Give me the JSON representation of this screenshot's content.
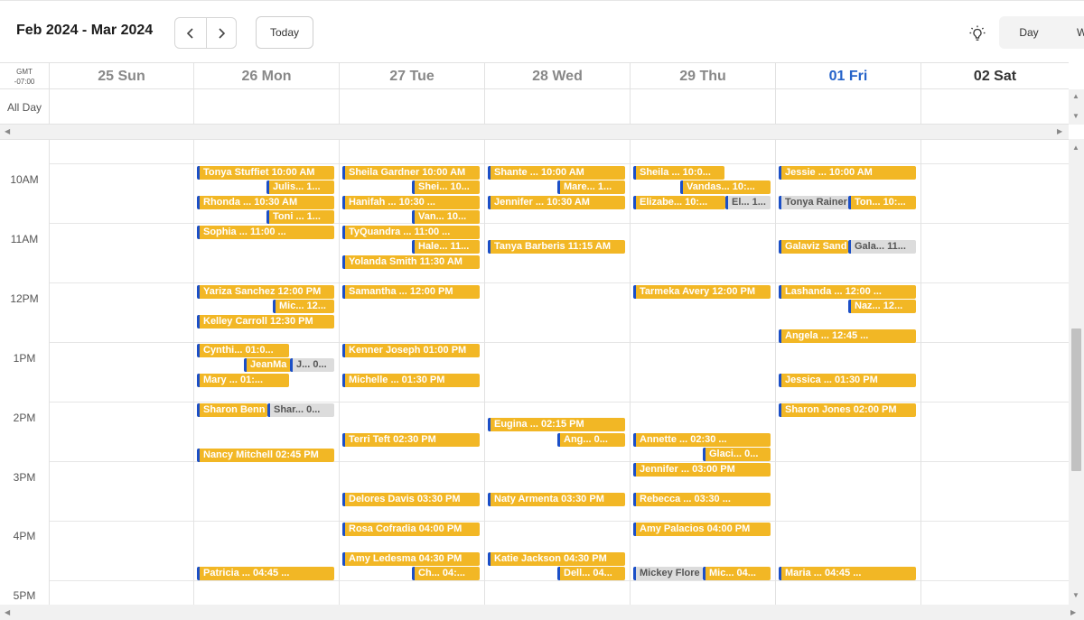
{
  "toolbar": {
    "range_title": "Feb 2024 - Mar 2024",
    "prev_icon": "chevron-left-icon",
    "next_icon": "chevron-right-icon",
    "today_label": "Today",
    "theme_icon": "lightbulb-icon",
    "view_day": "Day",
    "view_week": "W"
  },
  "header": {
    "gmt_line1": "GMT",
    "gmt_line2": "-07:00",
    "days": [
      "25 Sun",
      "26 Mon",
      "27 Tue",
      "28 Wed",
      "29 Thu",
      "01 Fri",
      "02 Sat"
    ]
  },
  "allday_label": "All Day",
  "time_labels": [
    "10AM",
    "11AM",
    "12PM",
    "1PM",
    "2PM",
    "3PM",
    "4PM",
    "5PM"
  ],
  "colors": {
    "event_fill": "#f2b725",
    "event_accent": "#1b4fc7",
    "event_alt_fill": "#dcdcdc",
    "today_text": "#2563c9"
  },
  "events": [
    {
      "day": 1,
      "text": "Tonya Stuffiet 10:00 AM",
      "style": "gold"
    },
    {
      "day": 1,
      "text": "Julis... 1...",
      "style": "gold"
    },
    {
      "day": 1,
      "text": "Rhonda ...     10:30 AM",
      "style": "gold"
    },
    {
      "day": 1,
      "text": "Toni ... 1...",
      "style": "gold"
    },
    {
      "day": 1,
      "text": "Sophia ...       11:00 ...",
      "style": "gold"
    },
    {
      "day": 1,
      "text": "Yariza Sanchez 12:00 PM",
      "style": "gold"
    },
    {
      "day": 1,
      "text": "Mic... 12...",
      "style": "gold"
    },
    {
      "day": 1,
      "text": "Kelley Carroll 12:30 PM",
      "style": "gold"
    },
    {
      "day": 1,
      "text": "Cynthi... 01:0...",
      "style": "gold"
    },
    {
      "day": 1,
      "text": "JeanMa",
      "style": "gold"
    },
    {
      "day": 1,
      "text": "J... 0...",
      "style": "gray"
    },
    {
      "day": 1,
      "text": "Mary ... 01:...",
      "style": "gold"
    },
    {
      "day": 1,
      "text": "Sharon Benn",
      "style": "gold"
    },
    {
      "day": 1,
      "text": "Shar... 0...",
      "style": "gray"
    },
    {
      "day": 1,
      "text": "Nancy Mitchell 02:45 PM",
      "style": "gold"
    },
    {
      "day": 1,
      "text": "Patricia ...      04:45 ...",
      "style": "gold"
    },
    {
      "day": 2,
      "text": "Sheila Gardner 10:00 AM",
      "style": "gold"
    },
    {
      "day": 2,
      "text": "Shei... 10...",
      "style": "gold"
    },
    {
      "day": 2,
      "text": "Hanifah ...      10:30 ...",
      "style": "gold"
    },
    {
      "day": 2,
      "text": "Van... 10...",
      "style": "gold"
    },
    {
      "day": 2,
      "text": "TyQuandra ...  11:00 ...",
      "style": "gold"
    },
    {
      "day": 2,
      "text": "Hale... 11...",
      "style": "gold"
    },
    {
      "day": 2,
      "text": "Yolanda Smith 11:30 AM",
      "style": "gold"
    },
    {
      "day": 2,
      "text": "Samantha ...      12:00 PM",
      "style": "gold"
    },
    {
      "day": 2,
      "text": "Kenner Joseph 01:00 PM",
      "style": "gold"
    },
    {
      "day": 2,
      "text": "Michelle ...       01:30 PM",
      "style": "gold"
    },
    {
      "day": 2,
      "text": "Terri Teft 02:30 PM",
      "style": "gold"
    },
    {
      "day": 2,
      "text": "Delores Davis 03:30 PM",
      "style": "gold"
    },
    {
      "day": 2,
      "text": "Rosa Cofradia 04:00 PM",
      "style": "gold"
    },
    {
      "day": 2,
      "text": "Amy Ledesma 04:30 PM",
      "style": "gold"
    },
    {
      "day": 2,
      "text": "Ch... 04:...",
      "style": "gold"
    },
    {
      "day": 3,
      "text": "Shante ...       10:00 AM",
      "style": "gold"
    },
    {
      "day": 3,
      "text": "Mare... 1...",
      "style": "gold"
    },
    {
      "day": 3,
      "text": "Jennifer ...      10:30 AM",
      "style": "gold"
    },
    {
      "day": 3,
      "text": "Tanya Barberis 11:15 AM",
      "style": "gold"
    },
    {
      "day": 3,
      "text": "Eugina ...        02:15 PM",
      "style": "gold"
    },
    {
      "day": 3,
      "text": "Ang... 0...",
      "style": "gold"
    },
    {
      "day": 3,
      "text": "Naty Armenta 03:30 PM",
      "style": "gold"
    },
    {
      "day": 3,
      "text": "Katie Jackson 04:30 PM",
      "style": "gold"
    },
    {
      "day": 3,
      "text": "Dell... 04...",
      "style": "gold"
    },
    {
      "day": 4,
      "text": "Sheila ...  10:0...",
      "style": "gold"
    },
    {
      "day": 4,
      "text": "Vandas... 10:...",
      "style": "gold"
    },
    {
      "day": 4,
      "text": "Elizabe... 10:...",
      "style": "gold"
    },
    {
      "day": 4,
      "text": "El... 1...",
      "style": "gray"
    },
    {
      "day": 4,
      "text": "Tarmeka Avery 12:00 PM",
      "style": "gold"
    },
    {
      "day": 4,
      "text": "Annette ...       02:30 ...",
      "style": "gold"
    },
    {
      "day": 4,
      "text": "Glaci... 0...",
      "style": "gold"
    },
    {
      "day": 4,
      "text": "Jennifer ...      03:00 PM",
      "style": "gold"
    },
    {
      "day": 4,
      "text": "Rebecca ...      03:30 ...",
      "style": "gold"
    },
    {
      "day": 4,
      "text": "Amy Palacios 04:00 PM",
      "style": "gold"
    },
    {
      "day": 4,
      "text": "Mickey Flore",
      "style": "gray"
    },
    {
      "day": 4,
      "text": "Mic... 04...",
      "style": "gold"
    },
    {
      "day": 5,
      "text": "Jessie ...         10:00 AM",
      "style": "gold"
    },
    {
      "day": 5,
      "text": "Tonya Rainer",
      "style": "gray"
    },
    {
      "day": 5,
      "text": "Ton... 10:...",
      "style": "gold"
    },
    {
      "day": 5,
      "text": "Galaviz Sand",
      "style": "gold"
    },
    {
      "day": 5,
      "text": "Gala... 11...",
      "style": "gray"
    },
    {
      "day": 5,
      "text": "Lashanda ...     12:00 ...",
      "style": "gold"
    },
    {
      "day": 5,
      "text": "Naz... 12...",
      "style": "gold"
    },
    {
      "day": 5,
      "text": "Angela ...         12:45 ...",
      "style": "gold"
    },
    {
      "day": 5,
      "text": "Jessica ...        01:30 PM",
      "style": "gold"
    },
    {
      "day": 5,
      "text": "Sharon Jones 02:00 PM",
      "style": "gold"
    },
    {
      "day": 5,
      "text": "Maria ...           04:45 ...",
      "style": "gold"
    }
  ]
}
